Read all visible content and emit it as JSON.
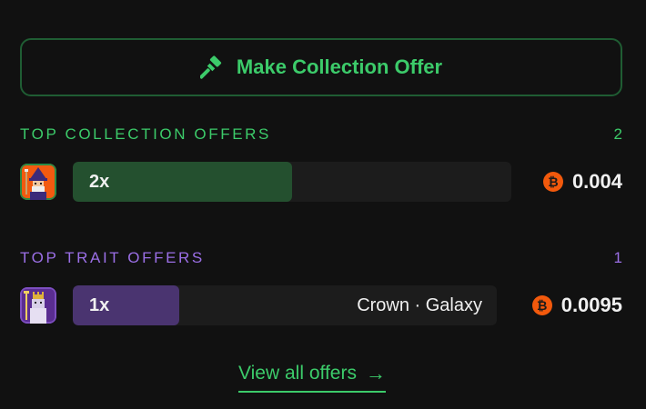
{
  "make_offer": {
    "label": "Make Collection Offer",
    "icon": "gavel-icon"
  },
  "collection_offers": {
    "title": "TOP COLLECTION OFFERS",
    "count": "2",
    "offer": {
      "quantity": "2x",
      "price": "0.004",
      "currency_icon": "bitcoin-icon",
      "fill_fraction": 0.5,
      "fill_color": "#24502f"
    }
  },
  "trait_offers": {
    "title": "TOP TRAIT OFFERS",
    "count": "1",
    "offer": {
      "quantity": "1x",
      "trait": "Crown · Galaxy",
      "price": "0.0095",
      "currency_icon": "bitcoin-icon",
      "fill_fraction": 0.25,
      "fill_color": "#4a3470"
    }
  },
  "view_all": {
    "label": "View all offers",
    "arrow": "→"
  },
  "colors": {
    "green": "#3ccb6a",
    "purple": "#9b6fe6",
    "btc_orange": "#f2590c"
  }
}
